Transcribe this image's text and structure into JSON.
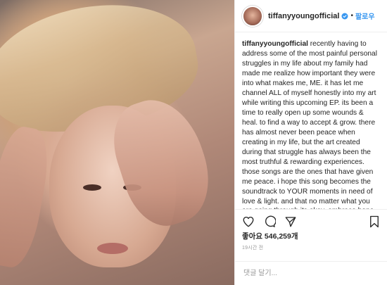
{
  "post": {
    "username": "tiffanyyoungofficial",
    "verified_icon": "verified-badge-icon",
    "follow_label": "팔로우",
    "caption_user": "tiffanyyoungofficial",
    "caption_text": " recently having to address some of the most painful personal struggles in my life about my family had made me realize how important they were into what makes me, ME. it has let me channel ALL of myself honestly into my art while writing this upcoming EP. its been a time to really open up some wounds & heal. to find a way to accept & grow. there has almost never been peace when creating in my life, but the art created during that struggle has always been the most truthful & rewarding experiences. those songs are the ones that have given me peace. i hope this song becomes the soundtrack to YOUR moments in need of love & light. and that no matter what you are going through its okay. embrace hope every single second & remember that no matter how much you just wanna give up, hold on until the moment of strength",
    "actions": {
      "like_icon": "heart-icon",
      "comment_icon": "comment-icon",
      "share_icon": "share-icon",
      "save_icon": "bookmark-icon"
    },
    "likes_text": "좋아요 546,259개",
    "time_text": "19시간 전",
    "comment_placeholder": "댓글 달기...",
    "colors": {
      "link": "#3897f0",
      "text": "#262626",
      "muted": "#999999",
      "border": "#efefef"
    }
  }
}
